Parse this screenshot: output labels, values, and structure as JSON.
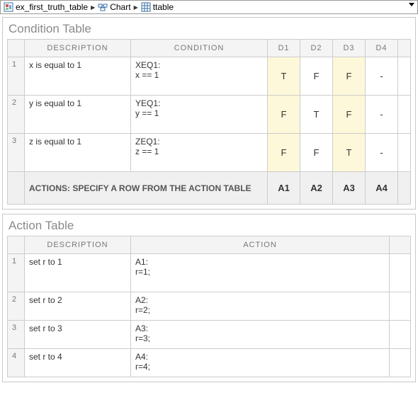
{
  "breadcrumb": {
    "items": [
      "ex_first_truth_table",
      "Chart",
      "ttable"
    ]
  },
  "condition_table": {
    "title": "Condition Table",
    "headers": {
      "num": "#",
      "desc": "DESCRIPTION",
      "cond": "CONDITION",
      "d": [
        "D1",
        "D2",
        "D3",
        "D4"
      ]
    },
    "rows": [
      {
        "num": "1",
        "desc": "x is equal to 1",
        "cond": "XEQ1:\nx == 1",
        "d": [
          "T",
          "F",
          "F",
          "-"
        ],
        "hl": [
          true,
          false,
          true,
          false
        ]
      },
      {
        "num": "2",
        "desc": "y is equal to 1",
        "cond": "YEQ1:\ny == 1",
        "d": [
          "F",
          "T",
          "F",
          "-"
        ],
        "hl": [
          true,
          false,
          true,
          false
        ]
      },
      {
        "num": "3",
        "desc": "z is equal to 1",
        "cond": "ZEQ1:\nz == 1",
        "d": [
          "F",
          "F",
          "T",
          "-"
        ],
        "hl": [
          true,
          false,
          true,
          false
        ]
      }
    ],
    "action_row": {
      "label": "ACTIONS: SPECIFY A ROW FROM THE ACTION TABLE",
      "d": [
        "A1",
        "A2",
        "A3",
        "A4"
      ],
      "hl": [
        true,
        false,
        true,
        false
      ]
    }
  },
  "action_table": {
    "title": "Action Table",
    "headers": {
      "num": "#",
      "desc": "DESCRIPTION",
      "act": "ACTION"
    },
    "rows": [
      {
        "num": "1",
        "desc": "set r to 1",
        "act": "A1:\nr=1;"
      },
      {
        "num": "2",
        "desc": "set r to 2",
        "act": "A2:\nr=2;"
      },
      {
        "num": "3",
        "desc": "set r to 3",
        "act": "A3:\nr=3;"
      },
      {
        "num": "4",
        "desc": "set r to 4",
        "act": "A4:\nr=4;"
      }
    ]
  }
}
